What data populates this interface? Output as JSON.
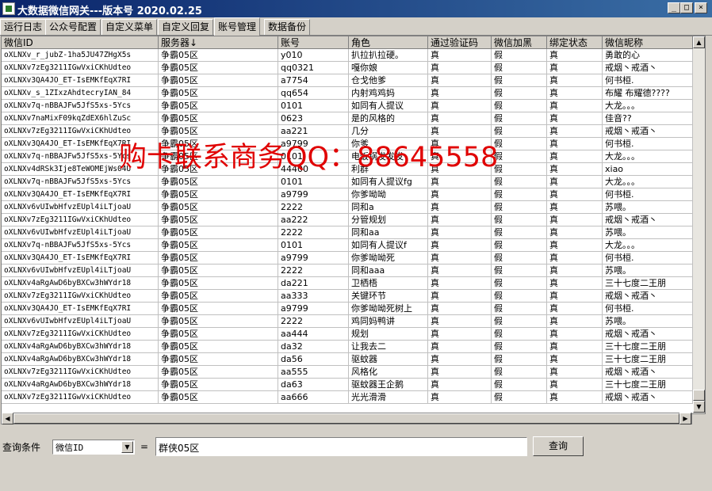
{
  "window": {
    "title": "大数据微信网关---版本号 2020.02.25",
    "controls": {
      "minimize": "_",
      "maximize": "□",
      "close": "×"
    }
  },
  "tabs": [
    {
      "label": "运行日志"
    },
    {
      "label": "公众号配置"
    },
    {
      "label": "自定义菜单"
    },
    {
      "label": "自定义回复"
    },
    {
      "label": "账号管理",
      "active": true
    },
    {
      "label": "数据备份"
    }
  ],
  "table": {
    "columns": [
      "微信ID",
      "服务器↓",
      "账号",
      "角色",
      "通过验证码",
      "微信加黑",
      "绑定状态",
      "微信昵称"
    ],
    "rows": [
      [
        "oXLNXv_r_jubZ-1ha5JU47ZHgX5s",
        "争霸05区",
        "y010",
        "扒拉扒拉硬。",
        "真",
        "假",
        "真",
        "勇敢的心"
      ],
      [
        "oXLNXv7zEg3211IGwVxiCKhUdteo",
        "争霸05区",
        "qq0321",
        "嘎你娘",
        "真",
        "假",
        "真",
        "戒烟丶戒酒丶"
      ],
      [
        "oXLNXv3QA4JO_ET-IsEMKfEqX7RI",
        "争霸05区",
        "a7754",
        "仓戈他爹",
        "真",
        "假",
        "真",
        "何书桓."
      ],
      [
        "oXLNXv_s_1ZIxzAhdtecryIAN_84",
        "争霸05区",
        "qq654",
        "内射鸡鸡妈",
        "真",
        "假",
        "真",
        "布耀 布耀德????"
      ],
      [
        "oXLNXv7q-nBBAJFw5JfS5xs-5Ycs",
        "争霸05区",
        "0101",
        "如同有人提议",
        "真",
        "假",
        "真",
        "大龙。。。"
      ],
      [
        "oXLNXv7naMixF09kqZdEX6hlZuSc",
        "争霸05区",
        "0623",
        "是的风格的",
        "真",
        "假",
        "真",
        "佳音??"
      ],
      [
        "oXLNXv7zEg3211IGwVxiCKhUdteo",
        "争霸05区",
        "aa221",
        "几分",
        "真",
        "假",
        "真",
        "戒烟丶戒酒丶"
      ],
      [
        "oXLNXv3QA4JO_ET-IsEMKfEqX7RI",
        "争霸05区",
        "a9799",
        "你爹",
        "真",
        "假",
        "真",
        "何书桓."
      ],
      [
        "oXLNXv7q-nBBAJFw5JfS5xs-5Ycs",
        "争霸05区",
        "0101",
        "电饭锅发发发",
        "真",
        "假",
        "真",
        "大龙。。。"
      ],
      [
        "oXLNXv4dRSk3Ije8TeWOMEjWs04U",
        "争霸05区",
        "44400",
        "利群",
        "真",
        "假",
        "真",
        "xiao"
      ],
      [
        "oXLNXv7q-nBBAJFw5JfS5xs-5Ycs",
        "争霸05区",
        "0101",
        "如同有人提议fg",
        "真",
        "假",
        "真",
        "大龙。。。"
      ],
      [
        "oXLNXv3QA4JO_ET-IsEMKfEqX7RI",
        "争霸05区",
        "a9799",
        "你爹呦呦",
        "真",
        "假",
        "真",
        "何书桓."
      ],
      [
        "oXLNXv6vUIwbHfvzEUpl4iLTjoaU",
        "争霸05区",
        "2222",
        "同和a",
        "真",
        "假",
        "真",
        "苏喂。"
      ],
      [
        "oXLNXv7zEg3211IGwVxiCKhUdteo",
        "争霸05区",
        "aa222",
        "分管规划",
        "真",
        "假",
        "真",
        "戒烟丶戒酒丶"
      ],
      [
        "oXLNXv6vUIwbHfvzEUpl4iLTjoaU",
        "争霸05区",
        "2222",
        "同和aa",
        "真",
        "假",
        "真",
        "苏喂。"
      ],
      [
        "oXLNXv7q-nBBAJFw5JfS5xs-5Ycs",
        "争霸05区",
        "0101",
        "如同有人提议f",
        "真",
        "假",
        "真",
        "大龙。。。"
      ],
      [
        "oXLNXv3QA4JO_ET-IsEMKfEqX7RI",
        "争霸05区",
        "a9799",
        "你爹呦呦死",
        "真",
        "假",
        "真",
        "何书桓."
      ],
      [
        "oXLNXv6vUIwbHfvzEUpl4iLTjoaU",
        "争霸05区",
        "2222",
        "同和aaa",
        "真",
        "假",
        "真",
        "苏喂。"
      ],
      [
        "oXLNXv4aRgAwD6byBXCw3hWYdr18",
        "争霸05区",
        "da221",
        "卫栖梧",
        "真",
        "假",
        "真",
        "三十七度二王朋"
      ],
      [
        "oXLNXv7zEg3211IGwVxiCKhUdteo",
        "争霸05区",
        "aa333",
        "关键环节",
        "真",
        "假",
        "真",
        "戒烟丶戒酒丶"
      ],
      [
        "oXLNXv3QA4JO_ET-IsEMKfEqX7RI",
        "争霸05区",
        "a9799",
        "你爹呦呦死树上",
        "真",
        "假",
        "真",
        "何书桓."
      ],
      [
        "oXLNXv6vUIwbHfvzEUpl4iLTjoaU",
        "争霸05区",
        "2222",
        "鸡同妈鸭讲",
        "真",
        "假",
        "真",
        "苏喂。"
      ],
      [
        "oXLNXv7zEg3211IGwVxiCKhUdteo",
        "争霸05区",
        "aa444",
        "规划",
        "真",
        "假",
        "真",
        "戒烟丶戒酒丶"
      ],
      [
        "oXLNXv4aRgAwD6byBXCw3hWYdr18",
        "争霸05区",
        "da32",
        "让我去二",
        "真",
        "假",
        "真",
        "三十七度二王朋"
      ],
      [
        "oXLNXv4aRgAwD6byBXCw3hWYdr18",
        "争霸05区",
        "da56",
        "驱蚊器",
        "真",
        "假",
        "真",
        "三十七度二王朋"
      ],
      [
        "oXLNXv7zEg3211IGwVxiCKhUdteo",
        "争霸05区",
        "aa555",
        "风格化",
        "真",
        "假",
        "真",
        "戒烟丶戒酒丶"
      ],
      [
        "oXLNXv4aRgAwD6byBXCw3hWYdr18",
        "争霸05区",
        "da63",
        "驱蚊器王企鹅",
        "真",
        "假",
        "真",
        "三十七度二王朋"
      ],
      [
        "oXLNXv7zEg3211IGwVxiCKhUdteo",
        "争霸05区",
        "aa666",
        "光光滑滑",
        "真",
        "假",
        "真",
        "戒烟丶戒酒丶"
      ]
    ]
  },
  "watermark": "购卡联系商务QQ：88645558",
  "query": {
    "label": "查询条件",
    "field_value": "微信ID",
    "equals": "=",
    "input_value": "群侠05区",
    "button_label": "查询"
  },
  "colors": {
    "titlebar_start": "#0a246a",
    "titlebar_end": "#3a6ea5",
    "watermark": "#e00000",
    "face": "#d4d0c8"
  }
}
